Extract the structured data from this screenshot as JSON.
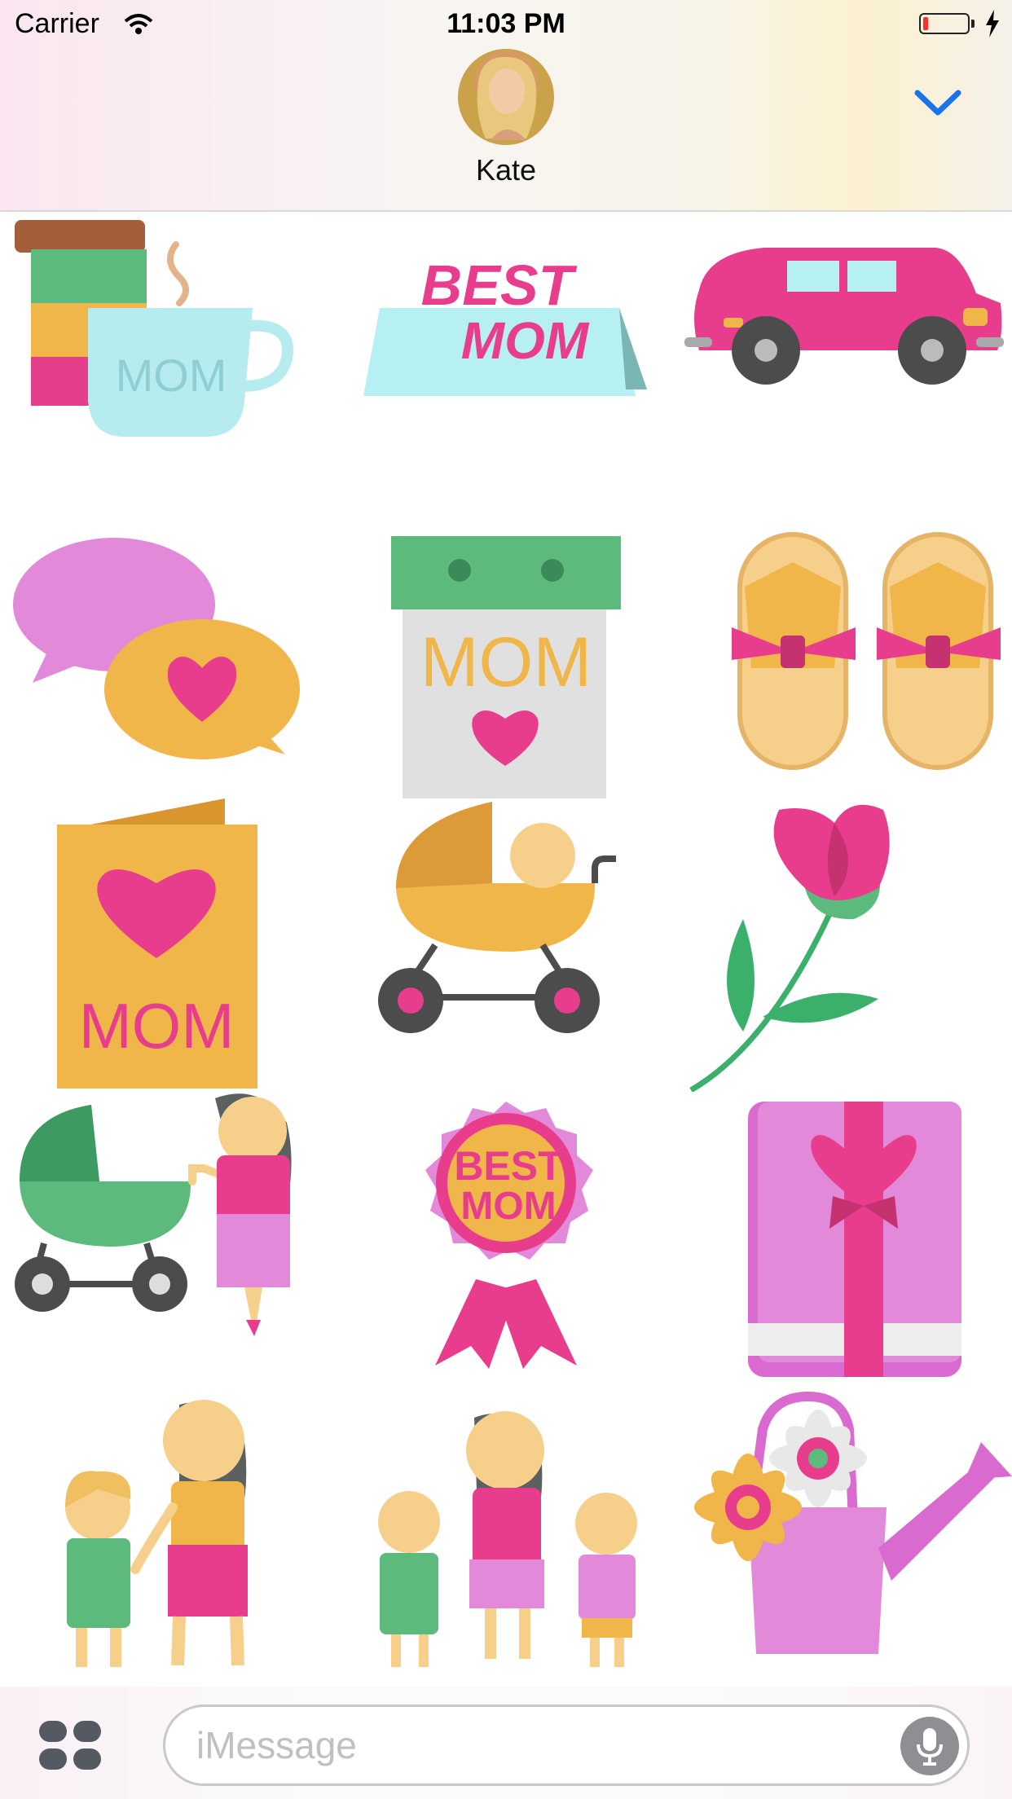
{
  "status_bar": {
    "carrier": "Carrier",
    "time": "11:03 PM",
    "battery_level": 0.12,
    "battery_color": "#ff2d2d"
  },
  "header": {
    "contact_name": "Kate",
    "accent_color": "#1a73e8"
  },
  "stickers": [
    {
      "name": "mom-mug-and-books",
      "text": "MOM"
    },
    {
      "name": "best-mom-sign",
      "text_line1": "BEST",
      "text_line2": "MOM"
    },
    {
      "name": "pink-car"
    },
    {
      "name": "love-speech-bubbles"
    },
    {
      "name": "mom-calendar",
      "text": "MOM"
    },
    {
      "name": "slippers"
    },
    {
      "name": "mom-heart-card",
      "text": "MOM"
    },
    {
      "name": "baby-stroller"
    },
    {
      "name": "pink-rose"
    },
    {
      "name": "mom-with-stroller"
    },
    {
      "name": "best-mom-badge",
      "text_line1": "BEST",
      "text_line2": "MOM"
    },
    {
      "name": "gift-box"
    },
    {
      "name": "mom-and-child"
    },
    {
      "name": "mom-and-two-kids"
    },
    {
      "name": "watering-can-flowers"
    }
  ],
  "compose": {
    "placeholder": "iMessage"
  }
}
